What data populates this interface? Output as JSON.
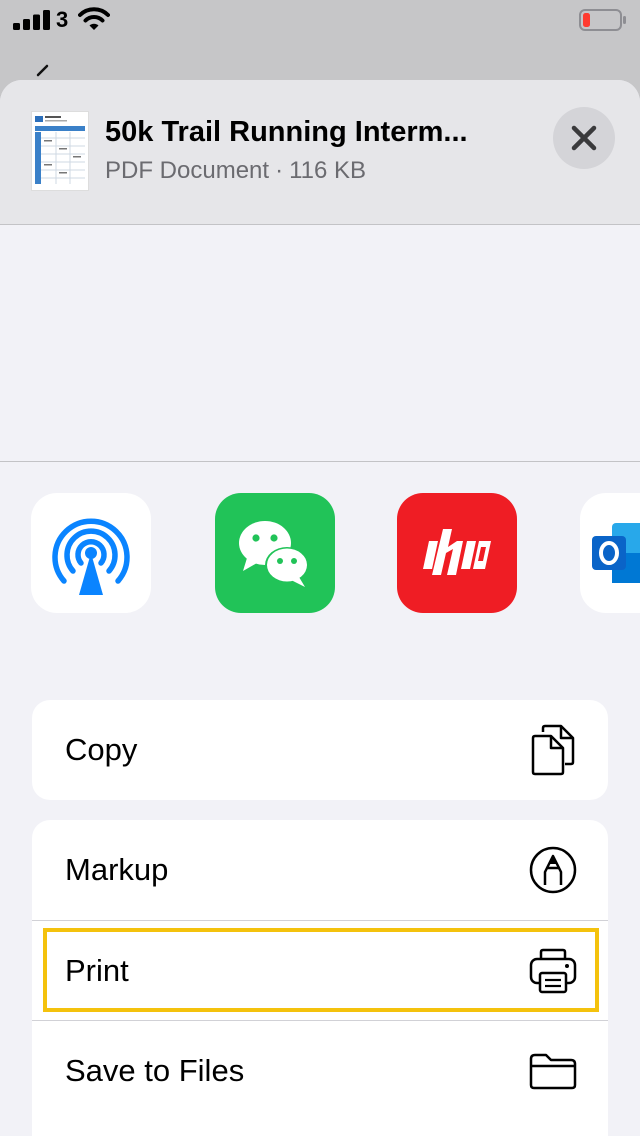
{
  "status_bar": {
    "carrier": "3",
    "signal_icon": "cellular-signal-icon",
    "wifi_icon": "wifi-icon",
    "battery_icon": "battery-low-icon",
    "battery_level": 0.15,
    "battery_color": "#ff3b30"
  },
  "share_sheet": {
    "document": {
      "title": "50k Trail Running Interm...",
      "type": "PDF Document",
      "separator": "·",
      "size": "116 KB"
    },
    "close_icon": "close-icon"
  },
  "apps": [
    {
      "name": "AirDrop",
      "icon": "airdrop-icon",
      "color": "#0a84ff"
    },
    {
      "name": "WeChat",
      "icon": "wechat-icon",
      "color": "#21c358"
    },
    {
      "name": "HP",
      "icon": "hp-icon",
      "color": "#ef1d24"
    },
    {
      "name": "Outlook",
      "icon": "outlook-icon",
      "color": "#0a64c8"
    }
  ],
  "actions": {
    "copy": {
      "label": "Copy",
      "icon": "copy-icon"
    },
    "markup": {
      "label": "Markup",
      "icon": "markup-pen-icon"
    },
    "print": {
      "label": "Print",
      "icon": "printer-icon"
    },
    "save_to_files": {
      "label": "Save to Files",
      "icon": "folder-icon"
    }
  },
  "highlight_color": "#f4c20d"
}
